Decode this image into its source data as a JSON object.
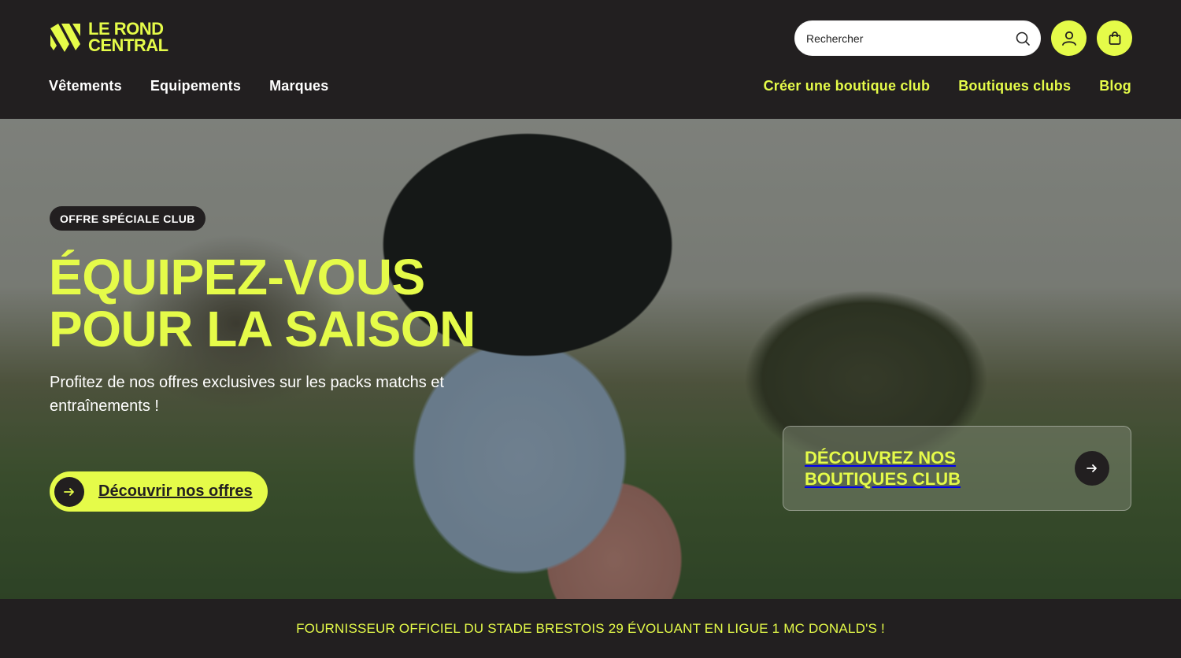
{
  "brand": {
    "logo_line1": "LE ROND",
    "logo_line2": "CENTRAL",
    "accent_color": "#e5fb49",
    "dark_color": "#221f20"
  },
  "header": {
    "search_placeholder": "Rechercher",
    "search_icon": "search-icon",
    "account_icon": "user-icon",
    "cart_icon": "bag-icon",
    "nav_left": [
      "Vêtements",
      "Equipements",
      "Marques"
    ],
    "nav_right": [
      "Créer une boutique club",
      "Boutiques clubs",
      "Blog"
    ]
  },
  "hero": {
    "badge": "OFFRE SPÉCIALE CLUB",
    "headline_line1": "ÉQUIPEZ-VOUS",
    "headline_line2": "POUR LA SAISON",
    "subtitle": "Profitez de nos offres exclusives sur les packs matchs et entraînements !",
    "cta_label": "Découvrir nos offres",
    "card_title_line1": "DÉCOUVREZ NOS",
    "card_title_line2": "BOUTIQUES CLUB"
  },
  "footer_bar": {
    "text": "FOURNISSEUR OFFICIEL DU STADE BRESTOIS 29 ÉVOLUANT EN LIGUE 1 MC DONALD'S !"
  }
}
